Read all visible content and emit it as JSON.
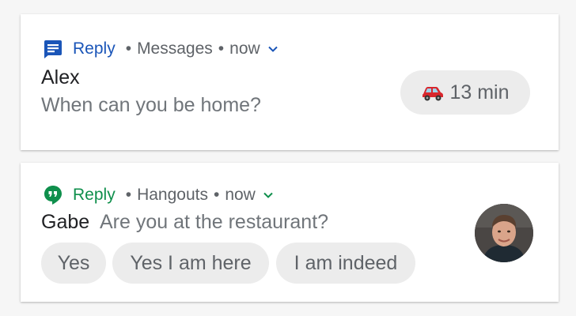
{
  "notifications": [
    {
      "app": "Messages",
      "app_name_color": "#1a55b8",
      "header_label": "Reply",
      "meta": "Messages",
      "time": "now",
      "icon": "messages-icon",
      "sender": "Alex",
      "message": "When can you be home?",
      "eta_chip": {
        "icon": "car-icon",
        "label": "13 min"
      }
    },
    {
      "app": "Hangouts",
      "app_name_color": "#0f8f4c",
      "header_label": "Reply",
      "meta": "Hangouts",
      "time": "now",
      "icon": "hangouts-icon",
      "sender": "Gabe",
      "message": "Are you at the restaurant?",
      "avatar": "contact-avatar",
      "smart_replies": [
        "Yes",
        "Yes I am here",
        "I am indeed"
      ]
    }
  ]
}
